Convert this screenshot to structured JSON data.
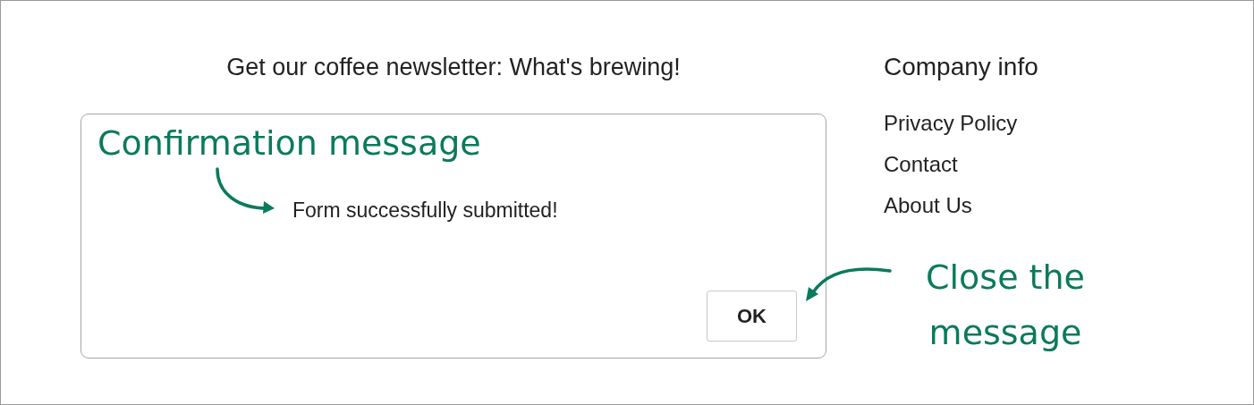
{
  "newsletter": {
    "heading": "Get our coffee newsletter: What's brewing!"
  },
  "dialog": {
    "message": "Form successfully submitted!",
    "button": "OK"
  },
  "company": {
    "heading": "Company info",
    "links": [
      "Privacy Policy",
      "Contact",
      "About Us"
    ]
  },
  "annotations": [
    {
      "text": "Confirmation message"
    },
    {
      "text": "Close the message"
    }
  ]
}
